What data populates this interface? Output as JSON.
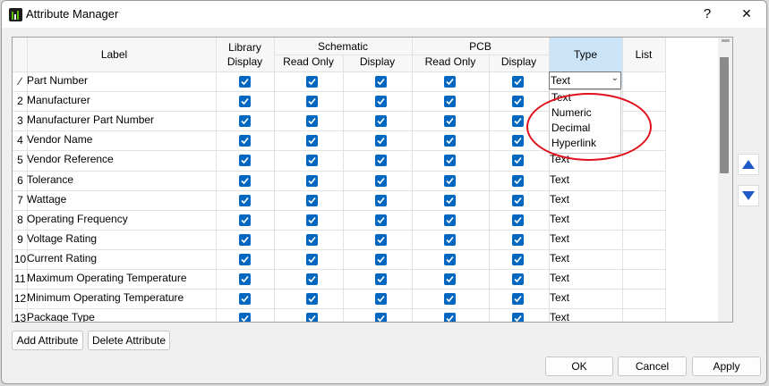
{
  "window": {
    "title": "Attribute Manager",
    "help": "?",
    "close": "✕"
  },
  "table": {
    "headers": {
      "label": "Label",
      "library_display": "Library\nDisplay",
      "schematic": "Schematic",
      "pcb": "PCB",
      "read_only": "Read Only",
      "display": "Display",
      "type": "Type",
      "list": "List"
    },
    "rows": [
      {
        "num": "∕",
        "label": "Part Number",
        "type": "Text"
      },
      {
        "num": "2",
        "label": "Manufacturer",
        "type": "Text"
      },
      {
        "num": "3",
        "label": "Manufacturer Part Number",
        "type": ""
      },
      {
        "num": "4",
        "label": "Vendor Name",
        "type": ""
      },
      {
        "num": "5",
        "label": "Vendor Reference",
        "type": "Text"
      },
      {
        "num": "6",
        "label": "Tolerance",
        "type": "Text"
      },
      {
        "num": "7",
        "label": "Wattage",
        "type": "Text"
      },
      {
        "num": "8",
        "label": "Operating Frequency",
        "type": "Text"
      },
      {
        "num": "9",
        "label": "Voltage Rating",
        "type": "Text"
      },
      {
        "num": "10",
        "label": "Current Rating",
        "type": "Text"
      },
      {
        "num": "11",
        "label": "Maximum Operating Temperature",
        "type": "Text"
      },
      {
        "num": "12",
        "label": "Minimum Operating Temperature",
        "type": "Text"
      },
      {
        "num": "13",
        "label": "Package Type",
        "type": "Text"
      }
    ],
    "checkbox_state": true,
    "type_dropdown": {
      "selected": "Text",
      "options": [
        "Text",
        "Numeric",
        "Decimal",
        "Hyperlink"
      ]
    }
  },
  "buttons": {
    "add_attribute": "Add Attribute",
    "delete_attribute": "Delete Attribute",
    "ok": "OK",
    "cancel": "Cancel",
    "apply": "Apply"
  },
  "icons": {
    "move_up": "up-arrow-icon",
    "move_down": "down-arrow-icon"
  },
  "colors": {
    "accent": "#0067c0",
    "selection": "#cce4f7",
    "annotation": "#e0101c"
  }
}
